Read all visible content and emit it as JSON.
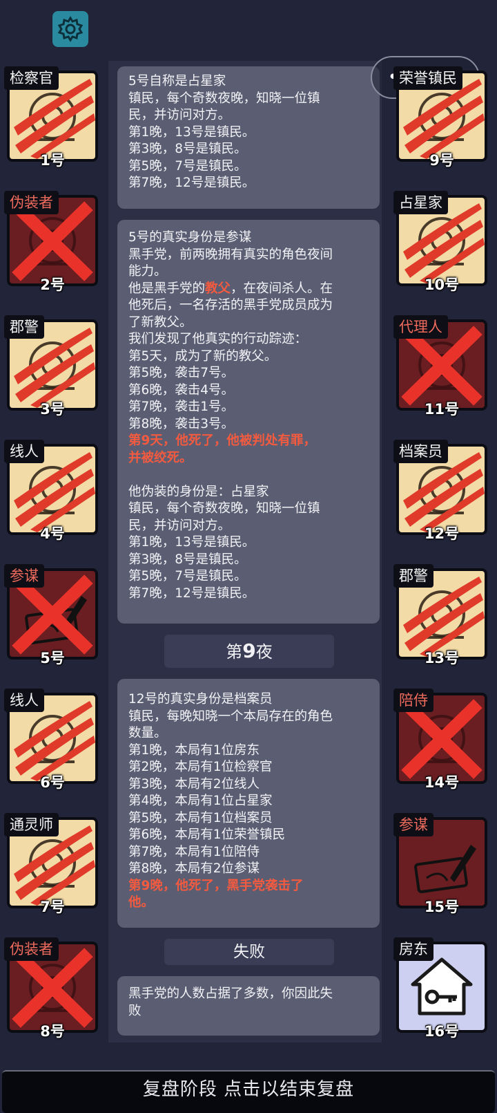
{
  "players": [
    {
      "role": "检察官",
      "num": "1号",
      "side": "left",
      "state": "scratched",
      "card": "alive",
      "tag_color": "white"
    },
    {
      "role": "伪装者",
      "num": "2号",
      "side": "left",
      "state": "crossed",
      "card": "evil",
      "tag_color": "red"
    },
    {
      "role": "郡警",
      "num": "3号",
      "side": "left",
      "state": "scratched",
      "card": "alive",
      "tag_color": "white"
    },
    {
      "role": "线人",
      "num": "4号",
      "side": "left",
      "state": "scratched",
      "card": "alive",
      "tag_color": "white"
    },
    {
      "role": "参谋",
      "num": "5号",
      "side": "left",
      "state": "crossed",
      "card": "evil",
      "tag_color": "red"
    },
    {
      "role": "线人",
      "num": "6号",
      "side": "left",
      "state": "scratched",
      "card": "alive",
      "tag_color": "white"
    },
    {
      "role": "通灵师",
      "num": "7号",
      "side": "left",
      "state": "scratched",
      "card": "alive",
      "tag_color": "white"
    },
    {
      "role": "伪装者",
      "num": "8号",
      "side": "left",
      "state": "crossed",
      "card": "evil",
      "tag_color": "red"
    },
    {
      "role": "荣誉镇民",
      "num": "9号",
      "side": "right",
      "state": "scratched",
      "card": "alive",
      "tag_color": "white"
    },
    {
      "role": "占星家",
      "num": "10号",
      "side": "right",
      "state": "scratched",
      "card": "alive",
      "tag_color": "white"
    },
    {
      "role": "代理人",
      "num": "11号",
      "side": "right",
      "state": "crossed",
      "card": "evil",
      "tag_color": "red"
    },
    {
      "role": "档案员",
      "num": "12号",
      "side": "right",
      "state": "scratched",
      "card": "alive",
      "tag_color": "white"
    },
    {
      "role": "郡警",
      "num": "13号",
      "side": "right",
      "state": "scratched",
      "card": "alive",
      "tag_color": "white"
    },
    {
      "role": "陪侍",
      "num": "14号",
      "side": "right",
      "state": "crossed",
      "card": "evil",
      "tag_color": "red"
    },
    {
      "role": "参谋",
      "num": "15号",
      "side": "right",
      "state": "alive",
      "card": "evil",
      "tag_color": "red"
    },
    {
      "role": "房东",
      "num": "16号",
      "side": "right",
      "state": "alive",
      "card": "blue",
      "tag_color": "white"
    }
  ],
  "box1": {
    "lines": [
      "5号自称是占星家",
      "镇民，每个奇数夜晚，知晓一位镇",
      "民，并访问对方。",
      "第1晚，13号是镇民。",
      "第3晚，8号是镇民。",
      "第5晚，7号是镇民。",
      "第7晚，12号是镇民。"
    ]
  },
  "box2": {
    "l1": "5号的真实身份是参谋",
    "l2": "黑手党，前两晚拥有真实的角色夜间",
    "l3": "能力。",
    "l4a": "他是黑手党的",
    "l4b": "教父",
    "l4c": "，在夜间杀人。在",
    "l5": "他死后，一名存活的黑手党成员成为",
    "l6": "了新教父。",
    "l7": "我们发现了他真实的行动踪迹：",
    "l8": "第5天，成为了新的教父。",
    "l9": "第5晚，袭击7号。",
    "l10": "第6晚，袭击4号。",
    "l11": "第7晚，袭击1号。",
    "l12": "第8晚，袭击3号。",
    "l13": "第9天，他死了，他被判处有罪，",
    "l14": "并被绞死。",
    "l15": "他伪装的身份是：占星家",
    "l16": "镇民，每个奇数夜晚，知晓一位镇",
    "l17": "民，并访问对方。",
    "l18": "第1晚，13号是镇民。",
    "l19": "第3晚，8号是镇民。",
    "l20": "第5晚，7号是镇民。",
    "l21": "第7晚，12号是镇民。"
  },
  "night_header": {
    "prefix": "第",
    "number": "9",
    "suffix": "夜"
  },
  "box3": {
    "lines": [
      "12号的真实身份是档案员",
      "镇民，每晚知晓一个本局存在的角色",
      "数量。",
      "第1晚，本局有1位房东",
      "第2晚，本局有1位检察官",
      "第3晚，本局有2位线人",
      "第4晚，本局有1位占星家",
      "第5晚，本局有1位档案员",
      "第6晚，本局有1位荣誉镇民",
      "第7晚，本局有1位陪侍",
      "第8晚，本局有2位参谋"
    ],
    "red1": "第9晚，他死了，黑手党袭击了",
    "red2": "他。"
  },
  "result_header": "失败",
  "box4": {
    "l1": "黑手党的人数占据了多数，你因此失",
    "l2": "败"
  },
  "bottom_bar": "复盘阶段 点击以结束复盘",
  "colors": {
    "background": "#22243a",
    "panel": "#2d2f47",
    "box": "#5b5e73",
    "highlight": "#f35a3f",
    "card_alive": "#f2dba6",
    "card_evil": "#6a1e22",
    "card_blue": "#cdd0f0"
  },
  "icons": {
    "settings": "gear-icon",
    "capsule_more": "more-dots-icon",
    "capsule_close": "close-target-icon"
  }
}
